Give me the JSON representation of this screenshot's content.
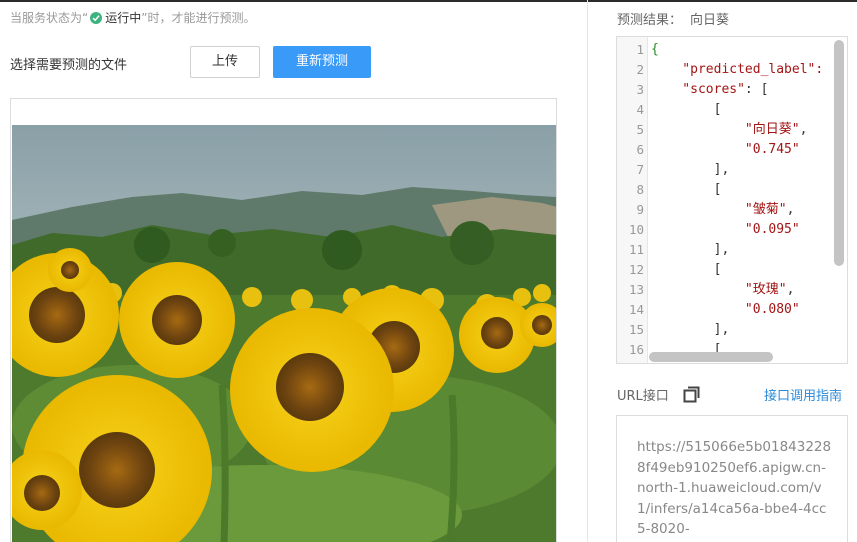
{
  "status_note": {
    "prefix": "当服务状态为“",
    "running": "运行中",
    "suffix": "”时，才能进行预测。"
  },
  "predict": {
    "select_label": "选择需要预测的文件",
    "upload_label": "上传",
    "repredict_label": "重新预测"
  },
  "result": {
    "title": "预测结果：",
    "label": "向日葵",
    "code_lines": [
      {
        "n": "1",
        "parts": [
          {
            "t": "{",
            "c": "g"
          }
        ]
      },
      {
        "n": "2",
        "parts": [
          {
            "t": "    \"predicted_label\": ",
            "c": "k"
          }
        ]
      },
      {
        "n": "3",
        "parts": [
          {
            "t": "    \"scores\"",
            "c": "k"
          },
          {
            "t": ": [",
            "c": "p"
          }
        ]
      },
      {
        "n": "4",
        "parts": [
          {
            "t": "        [",
            "c": "p"
          }
        ]
      },
      {
        "n": "5",
        "parts": [
          {
            "t": "            \"向日葵\"",
            "c": "s"
          },
          {
            "t": ",",
            "c": "p"
          }
        ]
      },
      {
        "n": "6",
        "parts": [
          {
            "t": "            \"0.745\"",
            "c": "s"
          }
        ]
      },
      {
        "n": "7",
        "parts": [
          {
            "t": "        ],",
            "c": "p"
          }
        ]
      },
      {
        "n": "8",
        "parts": [
          {
            "t": "        [",
            "c": "p"
          }
        ]
      },
      {
        "n": "9",
        "parts": [
          {
            "t": "            \"皱菊\"",
            "c": "s"
          },
          {
            "t": ",",
            "c": "p"
          }
        ]
      },
      {
        "n": "10",
        "parts": [
          {
            "t": "            \"0.095\"",
            "c": "s"
          }
        ]
      },
      {
        "n": "11",
        "parts": [
          {
            "t": "        ],",
            "c": "p"
          }
        ]
      },
      {
        "n": "12",
        "parts": [
          {
            "t": "        [",
            "c": "p"
          }
        ]
      },
      {
        "n": "13",
        "parts": [
          {
            "t": "            \"玫瑰\"",
            "c": "s"
          },
          {
            "t": ",",
            "c": "p"
          }
        ]
      },
      {
        "n": "14",
        "parts": [
          {
            "t": "            \"0.080\"",
            "c": "s"
          }
        ]
      },
      {
        "n": "15",
        "parts": [
          {
            "t": "        ],",
            "c": "p"
          }
        ]
      },
      {
        "n": "16",
        "parts": [
          {
            "t": "        [",
            "c": "p"
          }
        ]
      }
    ]
  },
  "url_section": {
    "label": "URL接口",
    "guide_link": "接口调用指南",
    "url": "https://515066e5b018432288f49eb910250ef6.apigw.cn-north-1.huaweicloud.com/v1/infers/a14ca56a-bbe4-4cc5-8020-"
  },
  "icons": {
    "status": "check-circle-icon",
    "copy": "copy-icon"
  },
  "colors": {
    "primary": "#3a9af7",
    "link": "#2a8bdb",
    "status_ok": "#3fb37f",
    "json_key": "#a31515",
    "json_brace": "#2a8a2a"
  }
}
